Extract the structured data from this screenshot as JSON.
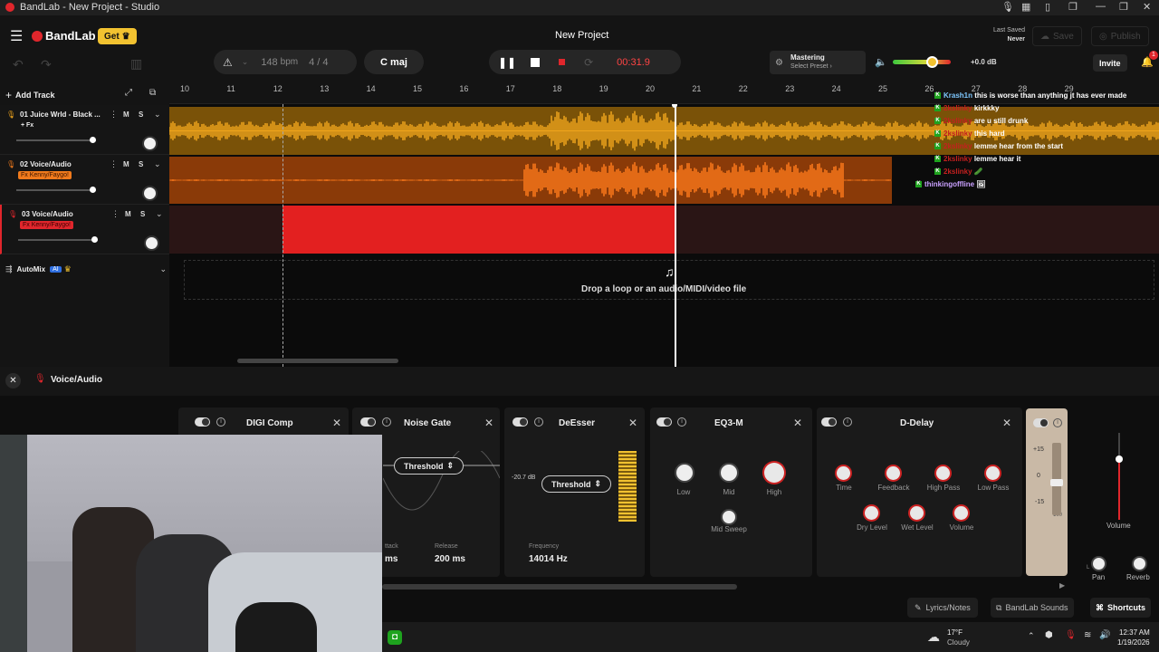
{
  "window": {
    "title": "BandLab - New Project - Studio"
  },
  "header": {
    "logo": "BandLab",
    "get_label": "Get",
    "project_title": "New Project",
    "last_saved_label": "Last Saved",
    "last_saved_value": "Never",
    "save_label": "Save",
    "publish_label": "Publish",
    "invite_label": "Invite",
    "notification_count": "1"
  },
  "transport": {
    "bpm": "148",
    "bpm_unit": "bpm",
    "time_signature": "4 / 4",
    "key": "C maj",
    "time": "00:31.9"
  },
  "mastering": {
    "label": "Mastering",
    "preset": "Select Preset"
  },
  "master_volume": {
    "db": "+0.0 dB",
    "level": 0.55
  },
  "toolbar": {
    "add_track": "Add Track"
  },
  "ruler": {
    "ticks": [
      "10",
      "11",
      "12",
      "13",
      "14",
      "15",
      "16",
      "17",
      "18",
      "19",
      "20",
      "21",
      "22",
      "23",
      "24",
      "25",
      "26",
      "27",
      "28",
      "29"
    ]
  },
  "tracks": [
    {
      "name": "01  Juice Wrld - Black ...",
      "fx": "+ Fx",
      "mute": "M",
      "solo": "S",
      "color": "#f0a51c"
    },
    {
      "name": "02  Voice/Audio",
      "fx": "Fx Kenny/Faygo!",
      "mute": "M",
      "solo": "S",
      "color": "#f07a1c"
    },
    {
      "name": "03  Voice/Audio",
      "fx": "Fx Kenny/Faygo!",
      "mute": "M",
      "solo": "S",
      "color": "#e0262c"
    }
  ],
  "automix": {
    "label": "AutoMix",
    "badge": "AI"
  },
  "drop_zone": {
    "text": "Drop a loop or an audio/MIDI/video file"
  },
  "chat": [
    {
      "user": "Krash1n",
      "msg": "this is worse than anything jt has ever made",
      "color": "#7ec8ff"
    },
    {
      "user": "2kslinky",
      "msg": "kirkkky",
      "color": "#c4201f"
    },
    {
      "user": "2kslinky",
      "msg": "are u still drunk",
      "color": "#c4201f"
    },
    {
      "user": "2kslinky",
      "msg": "this hard",
      "color": "#c4201f"
    },
    {
      "user": "2kslinky",
      "msg": "lemme hear from the start",
      "color": "#c4201f"
    },
    {
      "user": "2kslinky",
      "msg": "lemme hear it",
      "color": "#c4201f"
    },
    {
      "user": "2kslinky",
      "msg": "",
      "color": "#c4201f"
    },
    {
      "user": "thinkingoffline",
      "msg": "",
      "color": "#c9a0ff"
    }
  ],
  "fx_panel": {
    "track": "Voice/Audio"
  },
  "plugins": {
    "digi_comp": {
      "title": "DIGI Comp",
      "attack_label": "ttack",
      "attack_value": "ms"
    },
    "noise_gate": {
      "title": "Noise Gate",
      "param": "Threshold",
      "release_label": "Release",
      "release_value": "200 ms"
    },
    "deesser": {
      "title": "DeEsser",
      "param": "Threshold",
      "db": "-20.7 dB",
      "freq_label": "Frequency",
      "freq_value": "14014 Hz"
    },
    "eq3m": {
      "title": "EQ3-M",
      "knobs": [
        "Low",
        "Mid",
        "High",
        "Mid Sweep"
      ]
    },
    "ddelay": {
      "title": "D-Delay",
      "knobs": [
        "Time",
        "Feedback",
        "High Pass",
        "Low Pass",
        "Dry Level",
        "Wet Level",
        "Volume"
      ]
    }
  },
  "meter": {
    "scale": [
      "+15",
      "0",
      "-15"
    ],
    "extra": "100"
  },
  "channel": {
    "volume_label": "Volume",
    "pan_label": "Pan",
    "reverb_label": "Reverb",
    "lr": "L"
  },
  "bottom": {
    "lyrics": "Lyrics/Notes",
    "sounds": "BandLab Sounds",
    "shortcuts": "Shortcuts"
  },
  "taskbar": {
    "temp": "17°F",
    "weather": "Cloudy",
    "time": "12:37 AM",
    "date": "1/19/2026"
  }
}
